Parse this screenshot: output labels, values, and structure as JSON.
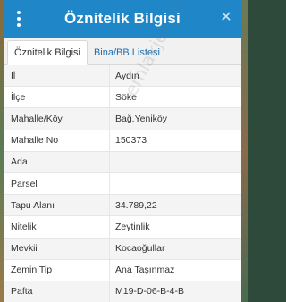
{
  "header": {
    "title": "Öznitelik Bilgisi"
  },
  "tabs": [
    {
      "label": "Öznitelik Bilgisi",
      "active": true
    },
    {
      "label": "Bina/BB Listesi",
      "active": false
    }
  ],
  "rows": [
    {
      "key": "İl",
      "value": "Aydın"
    },
    {
      "key": "İlçe",
      "value": "Söke"
    },
    {
      "key": "Mahalle/Köy",
      "value": "Bağ.Yeniköy"
    },
    {
      "key": "Mahalle No",
      "value": "150373"
    },
    {
      "key": "Ada",
      "value": ""
    },
    {
      "key": "Parsel",
      "value": ""
    },
    {
      "key": "Tapu Alanı",
      "value": "34.789,22"
    },
    {
      "key": "Nitelik",
      "value": "Zeytinlik"
    },
    {
      "key": "Mevkii",
      "value": "Kocaoğullar"
    },
    {
      "key": "Zemin Tip",
      "value": "Ana Taşınmaz"
    },
    {
      "key": "Pafta",
      "value": "M19-D-06-B-4-B"
    }
  ],
  "watermark": "emlakjet.com",
  "colors": {
    "header": "#1f86c8",
    "tab_link": "#1f6fb0"
  }
}
